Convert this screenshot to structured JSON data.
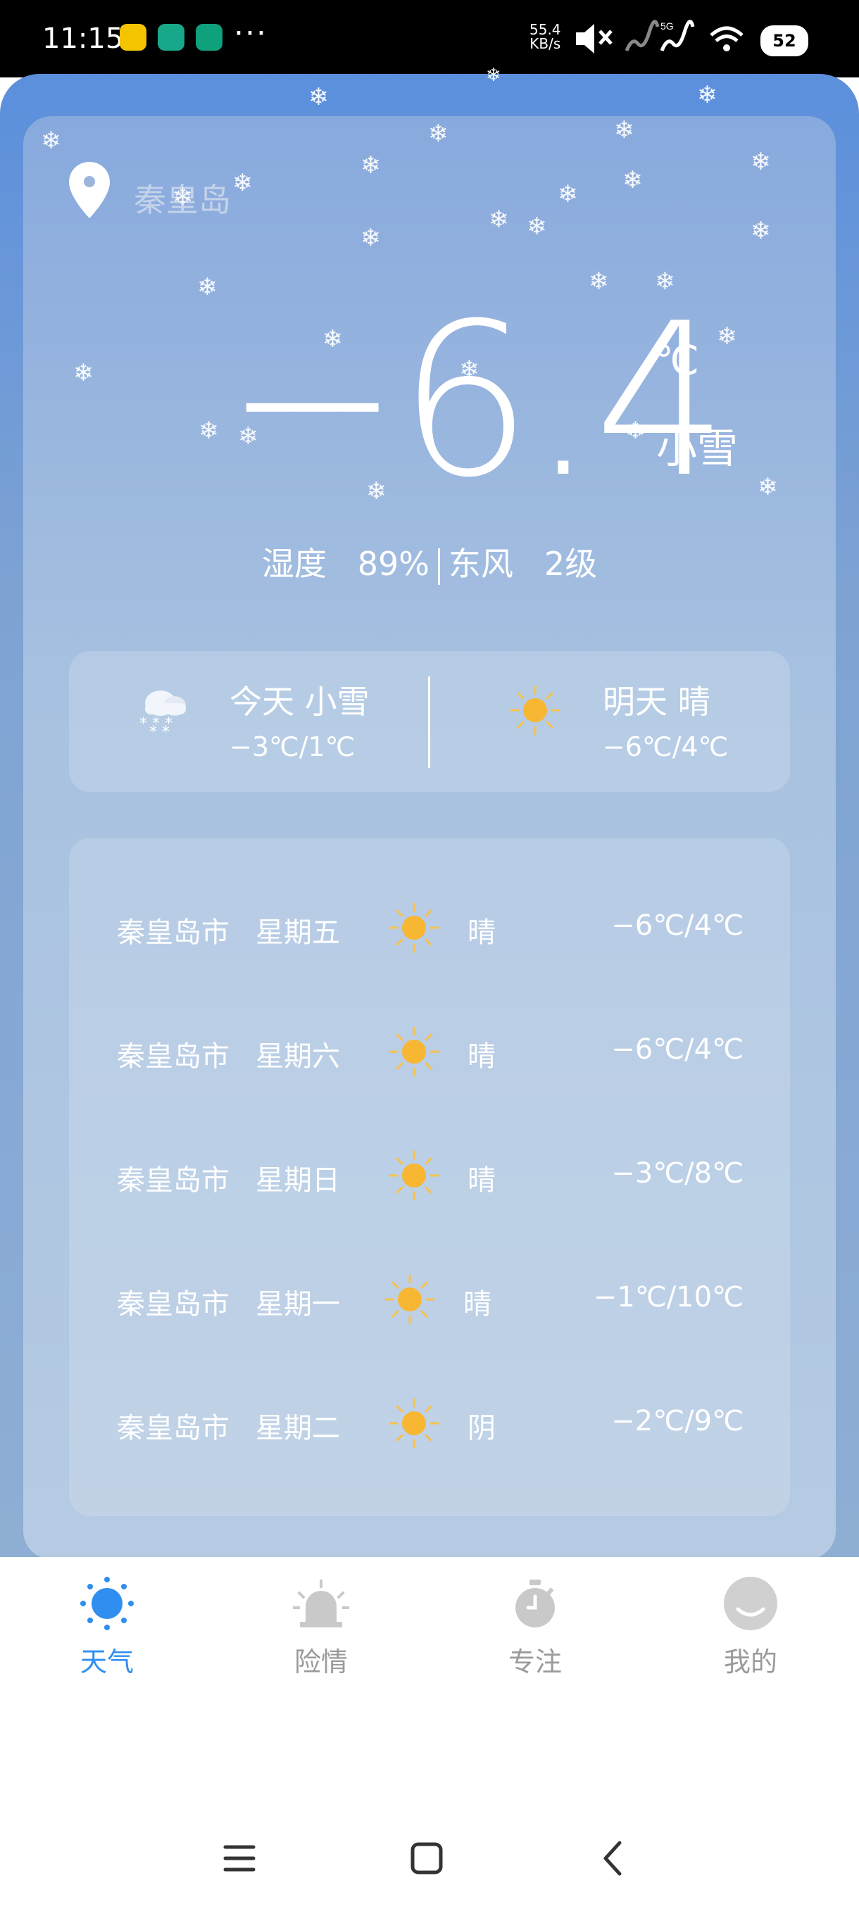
{
  "status_bar": {
    "time": "11:15",
    "network_speed_value": "55.4",
    "network_speed_unit": "KB/s",
    "signal_tag": "5G",
    "battery": "52",
    "dots": "···"
  },
  "location": {
    "name": "秦皇岛"
  },
  "current": {
    "temperature": "−6.4",
    "unit": "℃",
    "condition": "小雪",
    "humidity_label": "湿度",
    "humidity_value": "89%",
    "wind": "东风",
    "wind_level": "2级"
  },
  "today_tomorrow": {
    "today_title": "今天 小雪",
    "today_range": "−3℃/1℃",
    "tomorrow_title": "明天 晴",
    "tomorrow_range": "−6℃/4℃"
  },
  "forecast": [
    {
      "city": "秦皇岛市",
      "day": "星期五",
      "condition": "晴",
      "range": "−6℃/4℃",
      "icon": "sun-icon"
    },
    {
      "city": "秦皇岛市",
      "day": "星期六",
      "condition": "晴",
      "range": "−6℃/4℃",
      "icon": "sun-icon"
    },
    {
      "city": "秦皇岛市",
      "day": "星期日",
      "condition": "晴",
      "range": "−3℃/8℃",
      "icon": "sun-icon"
    },
    {
      "city": "秦皇岛市",
      "day": "星期一",
      "condition": "晴",
      "range": "−1℃/10℃",
      "icon": "sun-icon"
    },
    {
      "city": "秦皇岛市",
      "day": "星期二",
      "condition": "阴",
      "range": "−2℃/9℃",
      "icon": "sun-icon"
    }
  ],
  "nav": {
    "weather": "天气",
    "alerts": "险情",
    "focus": "专注",
    "mine": "我的"
  },
  "colors": {
    "active": "#2f8ef0",
    "inactive": "#9a9a9a",
    "sun": "#f7b733"
  }
}
